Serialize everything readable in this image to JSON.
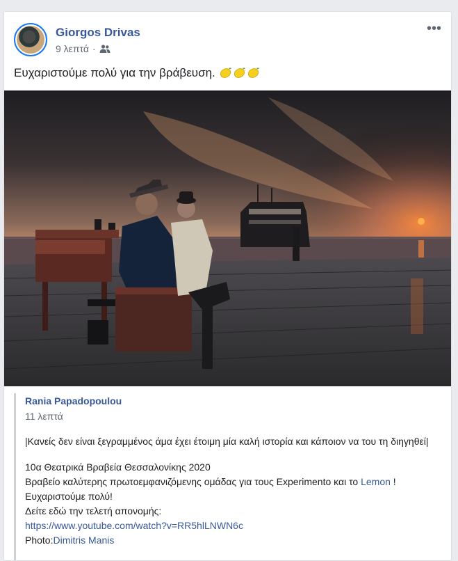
{
  "post": {
    "author": "Giorgos Drivas",
    "time": "9 λεπτά",
    "separator": "·",
    "audience_icon": "friends-icon",
    "more_label": "•••",
    "text": "Ευχαριστούμε πολύ για την βράβευση.",
    "emoji": [
      "lemon",
      "lemon",
      "lemon"
    ]
  },
  "photo": {
    "subject": "piano-player-at-sunset-harbor"
  },
  "shared": {
    "author": "Rania Papadopoulou",
    "time": "11 λεπτά",
    "quote": "|Κανείς δεν είναι ξεγραμμένος άμα έχει έτοιμη μία καλή ιστορία και κάποιον να του τη διηγηθεί|",
    "line1": "10α Θεατρικά Βραβεία Θεσσαλονίκης 2020",
    "line2_before": "Βραβείο καλύτερης πρωτοεμφανιζόμενης ομάδας για τους Experimento και το ",
    "line2_link": "Lemon",
    "line2_after": " !",
    "line3": "Ευχαριστούμε πολύ!",
    "line4": "Δείτε εδώ την τελετή απονομής:",
    "url": "https://www.youtube.com/watch?v=RR5hlLNWN6c",
    "photo_credit_label": "Photo:",
    "photo_credit_name": "Dimitris Manis"
  },
  "colors": {
    "link": "#385898",
    "accent": "#1877f2",
    "muted": "#606770"
  }
}
